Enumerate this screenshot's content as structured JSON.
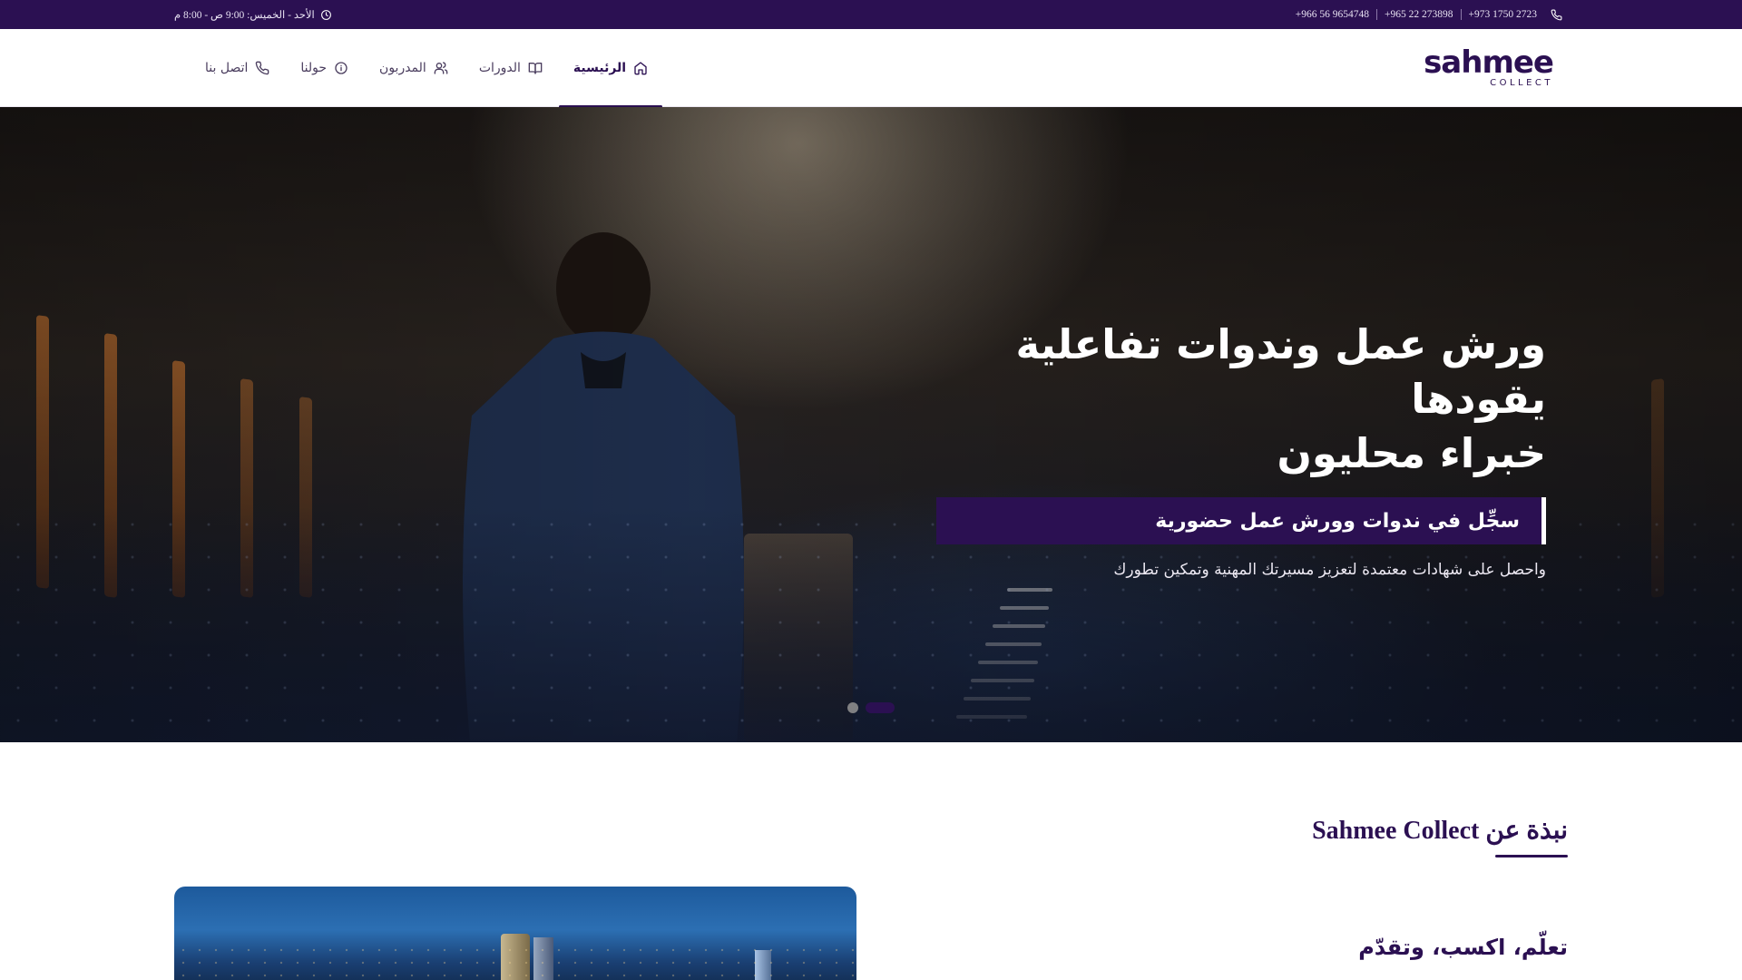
{
  "topbar": {
    "phones": [
      "+973 1750 2723",
      "+965 22 273898",
      "+966 56 9654748"
    ],
    "hours": "الأحد - الخميس: 9:00 ص - 8:00 م"
  },
  "header": {
    "logo": {
      "main": "sahmee",
      "sub": "COLLECT"
    },
    "nav": [
      {
        "label": "الرئيسية",
        "icon": "home-icon",
        "active": true
      },
      {
        "label": "الدورات",
        "icon": "book-icon",
        "active": false
      },
      {
        "label": "المدربون",
        "icon": "users-icon",
        "active": false
      },
      {
        "label": "حولنا",
        "icon": "info-icon",
        "active": false
      },
      {
        "label": "اتصل بنا",
        "icon": "phone-icon",
        "active": false
      }
    ]
  },
  "hero": {
    "title_line1": "ورش عمل وندوات تفاعلية يقودها",
    "title_line2": "خبراء محليون",
    "subtitle": "سجِّل في ندوات وورش عمل حضورية",
    "description": "واحصل على شهادات معتمدة لتعزيز مسيرتك المهنية وتمكين تطورك",
    "slides_total": 2,
    "slide_active": 1
  },
  "about": {
    "heading": "نبذة عن Sahmee Collect",
    "subheading": "تعلّم، اكسب، وتقدّم"
  },
  "colors": {
    "brand": "#2b1052",
    "topbar_bg": "#2b1052",
    "white": "#ffffff"
  }
}
